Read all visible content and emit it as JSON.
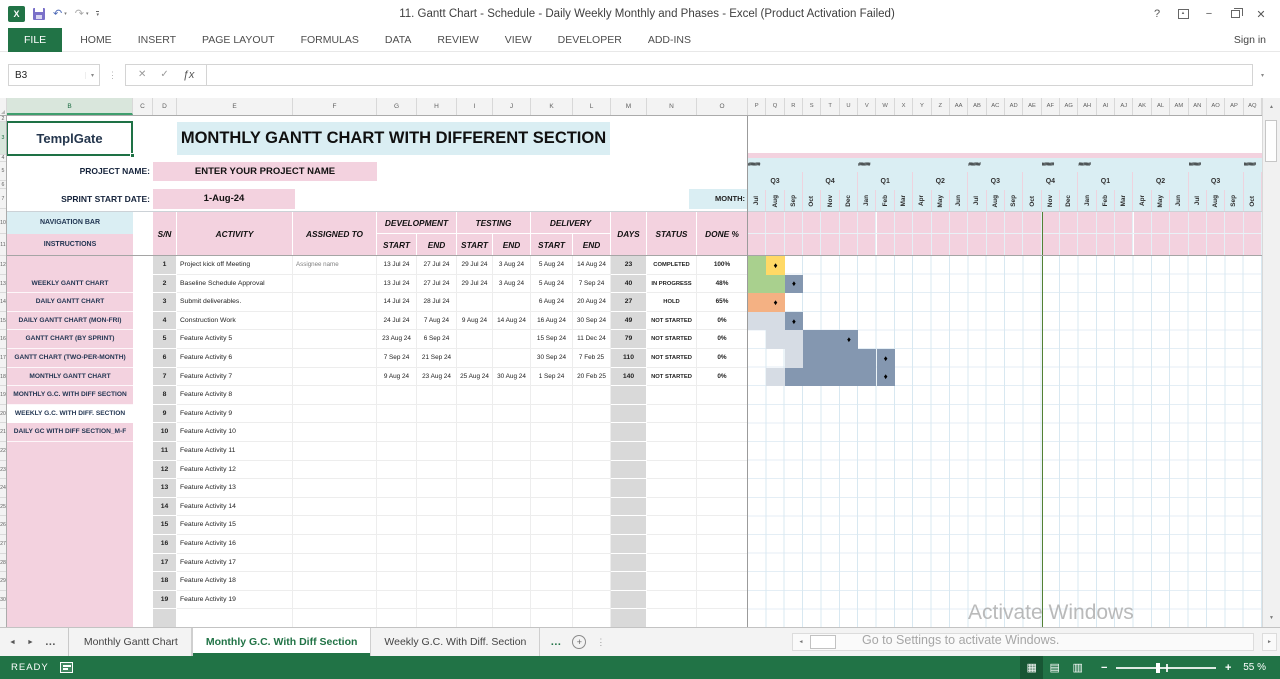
{
  "window": {
    "title": "11. Gantt Chart - Schedule - Daily Weekly Monthly and Phases - Excel (Product Activation Failed)",
    "sign_in": "Sign in"
  },
  "ribbon": {
    "tabs": [
      "FILE",
      "HOME",
      "INSERT",
      "PAGE LAYOUT",
      "FORMULAS",
      "DATA",
      "REVIEW",
      "VIEW",
      "DEVELOPER",
      "ADD-INS"
    ]
  },
  "formula_bar": {
    "name_box": "B3",
    "formula_value": ""
  },
  "icons": {
    "undo": "↶",
    "redo": "↷",
    "dropdown": "▾",
    "help": "?",
    "minimize": "−",
    "close": "✕",
    "cancel": "✕",
    "enter": "✓",
    "function": "ƒx",
    "dots": "⋮",
    "left_arrow": "◄",
    "right_arrow": "►",
    "up_arrow": "▲",
    "down_arrow": "▼",
    "ellipsis": "…",
    "plus": "+",
    "zoom_out": "−",
    "zoom_in": "+",
    "diamond": "♦",
    "hash": "#####",
    "views": [
      "▦",
      "▤",
      "▥"
    ]
  },
  "grid": {
    "selected_col": "B",
    "selected_row": "3",
    "left_cols": [
      [
        "B",
        126
      ],
      [
        "C",
        20
      ],
      [
        "D",
        24
      ],
      [
        "E",
        116
      ],
      [
        "F",
        84
      ],
      [
        "G",
        40
      ],
      [
        "H",
        40
      ],
      [
        "I",
        36
      ],
      [
        "J",
        38
      ],
      [
        "K",
        42
      ],
      [
        "L",
        38
      ],
      [
        "M",
        36
      ],
      [
        "N",
        50
      ],
      [
        "O",
        51
      ]
    ],
    "gantt_cols": [
      "P",
      "Q",
      "R",
      "S",
      "T",
      "U",
      "V",
      "W",
      "X",
      "Y",
      "Z",
      "AA",
      "AB",
      "AC",
      "AD",
      "AE",
      "AF",
      "AG",
      "AH",
      "AI",
      "AJ",
      "AK",
      "AL",
      "AM",
      "AN",
      "AO",
      "AP",
      "AQ"
    ],
    "rows": [
      [
        "2",
        6
      ],
      [
        "3",
        33
      ],
      [
        "4",
        7
      ],
      [
        "5",
        19
      ],
      [
        "6",
        8
      ],
      [
        "7",
        20
      ],
      [
        "",
        3
      ],
      [
        "10",
        22
      ],
      [
        "11",
        22
      ],
      [
        "12",
        18.6
      ],
      [
        "13",
        18.6
      ],
      [
        "14",
        18.6
      ],
      [
        "15",
        18.6
      ],
      [
        "16",
        18.6
      ],
      [
        "17",
        18.6
      ],
      [
        "18",
        18.6
      ],
      [
        "19",
        18.6
      ],
      [
        "20",
        18.6
      ],
      [
        "21",
        18.6
      ],
      [
        "22",
        18.6
      ],
      [
        "23",
        18.6
      ],
      [
        "24",
        18.6
      ],
      [
        "25",
        18.6
      ],
      [
        "26",
        18.6
      ],
      [
        "27",
        18.6
      ],
      [
        "28",
        18.6
      ],
      [
        "29",
        18.6
      ],
      [
        "30",
        18.6
      ]
    ]
  },
  "sheet": {
    "logo": "TemplGate",
    "title": "MONTHLY GANTT CHART WITH DIFFERENT SECTION",
    "project_name_label": "PROJECT NAME:",
    "project_name_value": "ENTER YOUR PROJECT NAME",
    "sprint_label": "SPRINT START DATE:",
    "sprint_value": "1-Aug-24",
    "month_label": "MONTH:",
    "nav": {
      "header_top": "NAVIGATION BAR",
      "header_bottom": "INSTRUCTIONS",
      "active_index": 7,
      "items": [
        "WEEKLY GANTT CHART",
        "DAILY GANTT CHART",
        "DAILY GANTT CHART (MON-FRI)",
        "GANTT CHART (BY SPRINT)",
        "GANTT CHART (TWO-PER-MONTH)",
        "MONTHLY GANTT CHART",
        "MONTHLY G.C. WITH DIFF SECTION",
        "WEEKLY G.C. WITH DIFF. SECTION",
        "DAILY GC WITH DIFF SECTION_M-F"
      ]
    },
    "table": {
      "headers": {
        "sn": "S/N",
        "activity": "ACTIVITY",
        "assigned": "ASSIGNED TO",
        "development": "DEVELOPMENT",
        "testing": "TESTING",
        "delivery": "DELIVERY",
        "start": "START",
        "end": "END",
        "days": "DAYS",
        "status": "STATUS",
        "done": "DONE %"
      },
      "rows": [
        {
          "sn": "1",
          "activity": "Project kick off Meeting",
          "assigned": "Assignee name",
          "dev_start": "13 Jul 24",
          "dev_end": "27 Jul 24",
          "test_start": "29 Jul 24",
          "test_end": "3 Aug 24",
          "del_start": "5 Aug 24",
          "del_end": "14 Aug 24",
          "days": "23",
          "status": "COMPLETED",
          "done": "100%"
        },
        {
          "sn": "2",
          "activity": "Baseline Schedule Approval",
          "assigned": "",
          "dev_start": "13 Jul 24",
          "dev_end": "27 Jul 24",
          "test_start": "29 Jul 24",
          "test_end": "3 Aug 24",
          "del_start": "5 Aug 24",
          "del_end": "7 Sep 24",
          "days": "40",
          "status": "IN PROGRESS",
          "done": "48%"
        },
        {
          "sn": "3",
          "activity": "Submit deliverables.",
          "assigned": "",
          "dev_start": "14 Jul 24",
          "dev_end": "28 Jul 24",
          "test_start": "",
          "test_end": "",
          "del_start": "6 Aug 24",
          "del_end": "20 Aug 24",
          "days": "27",
          "status": "HOLD",
          "done": "65%"
        },
        {
          "sn": "4",
          "activity": "Construction Work",
          "assigned": "",
          "dev_start": "24 Jul 24",
          "dev_end": "7 Aug 24",
          "test_start": "9 Aug 24",
          "test_end": "14 Aug 24",
          "del_start": "16 Aug 24",
          "del_end": "30 Sep 24",
          "days": "49",
          "status": "NOT STARTED",
          "done": "0%"
        },
        {
          "sn": "5",
          "activity": "Feature Activity 5",
          "assigned": "",
          "dev_start": "23 Aug 24",
          "dev_end": "6 Sep 24",
          "test_start": "",
          "test_end": "",
          "del_start": "15 Sep 24",
          "del_end": "11 Dec 24",
          "days": "79",
          "status": "NOT STARTED",
          "done": "0%"
        },
        {
          "sn": "6",
          "activity": "Feature Activity 6",
          "assigned": "",
          "dev_start": "7 Sep 24",
          "dev_end": "21 Sep 24",
          "test_start": "",
          "test_end": "",
          "del_start": "30 Sep 24",
          "del_end": "7 Feb 25",
          "days": "110",
          "status": "NOT STARTED",
          "done": "0%"
        },
        {
          "sn": "7",
          "activity": "Feature Activity 7",
          "assigned": "",
          "dev_start": "9 Aug 24",
          "dev_end": "23 Aug 24",
          "test_start": "25 Aug 24",
          "test_end": "30 Aug 24",
          "del_start": "1 Sep 24",
          "del_end": "20 Feb 25",
          "days": "140",
          "status": "NOT STARTED",
          "done": "0%"
        },
        {
          "sn": "8",
          "activity": "Feature Activity 8",
          "assigned": "",
          "dev_start": "",
          "dev_end": "",
          "test_start": "",
          "test_end": "",
          "del_start": "",
          "del_end": "",
          "days": "",
          "status": "",
          "done": ""
        },
        {
          "sn": "9",
          "activity": "Feature Activity 9",
          "assigned": "",
          "dev_start": "",
          "dev_end": "",
          "test_start": "",
          "test_end": "",
          "del_start": "",
          "del_end": "",
          "days": "",
          "status": "",
          "done": ""
        },
        {
          "sn": "10",
          "activity": "Feature Activity 10",
          "assigned": "",
          "dev_start": "",
          "dev_end": "",
          "test_start": "",
          "test_end": "",
          "del_start": "",
          "del_end": "",
          "days": "",
          "status": "",
          "done": ""
        },
        {
          "sn": "11",
          "activity": "Feature Activity 11",
          "assigned": "",
          "dev_start": "",
          "dev_end": "",
          "test_start": "",
          "test_end": "",
          "del_start": "",
          "del_end": "",
          "days": "",
          "status": "",
          "done": ""
        },
        {
          "sn": "12",
          "activity": "Feature Activity 12",
          "assigned": "",
          "dev_start": "",
          "dev_end": "",
          "test_start": "",
          "test_end": "",
          "del_start": "",
          "del_end": "",
          "days": "",
          "status": "",
          "done": ""
        },
        {
          "sn": "13",
          "activity": "Feature Activity 13",
          "assigned": "",
          "dev_start": "",
          "dev_end": "",
          "test_start": "",
          "test_end": "",
          "del_start": "",
          "del_end": "",
          "days": "",
          "status": "",
          "done": ""
        },
        {
          "sn": "14",
          "activity": "Feature Activity 14",
          "assigned": "",
          "dev_start": "",
          "dev_end": "",
          "test_start": "",
          "test_end": "",
          "del_start": "",
          "del_end": "",
          "days": "",
          "status": "",
          "done": ""
        },
        {
          "sn": "15",
          "activity": "Feature Activity 15",
          "assigned": "",
          "dev_start": "",
          "dev_end": "",
          "test_start": "",
          "test_end": "",
          "del_start": "",
          "del_end": "",
          "days": "",
          "status": "",
          "done": ""
        },
        {
          "sn": "16",
          "activity": "Feature Activity 16",
          "assigned": "",
          "dev_start": "",
          "dev_end": "",
          "test_start": "",
          "test_end": "",
          "del_start": "",
          "del_end": "",
          "days": "",
          "status": "",
          "done": ""
        },
        {
          "sn": "17",
          "activity": "Feature Activity 17",
          "assigned": "",
          "dev_start": "",
          "dev_end": "",
          "test_start": "",
          "test_end": "",
          "del_start": "",
          "del_end": "",
          "days": "",
          "status": "",
          "done": ""
        },
        {
          "sn": "18",
          "activity": "Feature Activity 18",
          "assigned": "",
          "dev_start": "",
          "dev_end": "",
          "test_start": "",
          "test_end": "",
          "del_start": "",
          "del_end": "",
          "days": "",
          "status": "",
          "done": ""
        },
        {
          "sn": "19",
          "activity": "Feature Activity 19",
          "assigned": "",
          "dev_start": "",
          "dev_end": "",
          "test_start": "",
          "test_end": "",
          "del_start": "",
          "del_end": "",
          "days": "",
          "status": "",
          "done": ""
        }
      ]
    },
    "gantt": {
      "months": [
        "Jul",
        "Aug",
        "Sep",
        "Oct",
        "Nov",
        "Dec",
        "Jan",
        "Feb",
        "Mar",
        "Apr",
        "May",
        "Jun",
        "Jul",
        "Aug",
        "Sep",
        "Oct",
        "Nov",
        "Dec",
        "Jan",
        "Feb",
        "Mar",
        "Apr",
        "May",
        "Jun",
        "Jul",
        "Aug",
        "Sep",
        "Oct"
      ],
      "quarters": [
        [
          "Q3",
          3
        ],
        [
          "Q4",
          3
        ],
        [
          "Q1",
          3
        ],
        [
          "Q2",
          3
        ],
        [
          "Q3",
          3
        ],
        [
          "Q4",
          3
        ],
        [
          "Q1",
          3
        ],
        [
          "Q2",
          3
        ],
        [
          "Q3",
          3
        ],
        [
          "",
          1
        ]
      ],
      "year_mark_cols": [
        0,
        6,
        12,
        16,
        18,
        24,
        27
      ],
      "colors": {
        "green": "#a9d08e",
        "yellow": "#ffd966",
        "orange": "#f4b183",
        "lightslate": "#d6dce4",
        "slate": "#8497b0",
        "band_blue": "#daeef3",
        "band_pink": "#f3d2df"
      },
      "bars": [
        [
          [
            0,
            "green",
            false
          ],
          [
            1,
            "yellow",
            true
          ]
        ],
        [
          [
            0,
            "green",
            false
          ],
          [
            1,
            "green",
            false
          ],
          [
            2,
            "slate",
            true
          ]
        ],
        [
          [
            0,
            "orange",
            false
          ],
          [
            1,
            "orange",
            true
          ]
        ],
        [
          [
            0,
            "lightslate",
            false
          ],
          [
            1,
            "lightslate",
            false
          ],
          [
            2,
            "slate",
            true
          ]
        ],
        [
          [
            1,
            "lightslate",
            false
          ],
          [
            2,
            "lightslate",
            false
          ],
          [
            3,
            "slate",
            false
          ],
          [
            4,
            "slate",
            false
          ],
          [
            5,
            "slate",
            true
          ]
        ],
        [
          [
            2,
            "lightsl",
            false
          ],
          [
            3,
            "slate",
            false
          ],
          [
            4,
            "slate",
            false
          ],
          [
            5,
            "slate",
            false
          ],
          [
            6,
            "slate",
            false
          ],
          [
            7,
            "slate",
            true
          ]
        ],
        [
          [
            1,
            "lightslate",
            false
          ],
          [
            2,
            "slate",
            false
          ],
          [
            3,
            "slate",
            false
          ],
          [
            4,
            "slate",
            false
          ],
          [
            5,
            "slate",
            false
          ],
          [
            6,
            "slate",
            false
          ],
          [
            7,
            "slate",
            true
          ]
        ]
      ]
    }
  },
  "tabs_bar": {
    "tabs": [
      {
        "label": "Monthly Gantt Chart",
        "active": false
      },
      {
        "label": "Monthly G.C. With Diff Section",
        "active": true
      },
      {
        "label": "Weekly G.C. With Diff. Section",
        "active": false
      }
    ]
  },
  "status_bar": {
    "mode": "READY",
    "zoom_level": "55 %"
  },
  "watermark": {
    "line1": "Activate Windows",
    "line2": "Go to Settings to activate Windows."
  }
}
